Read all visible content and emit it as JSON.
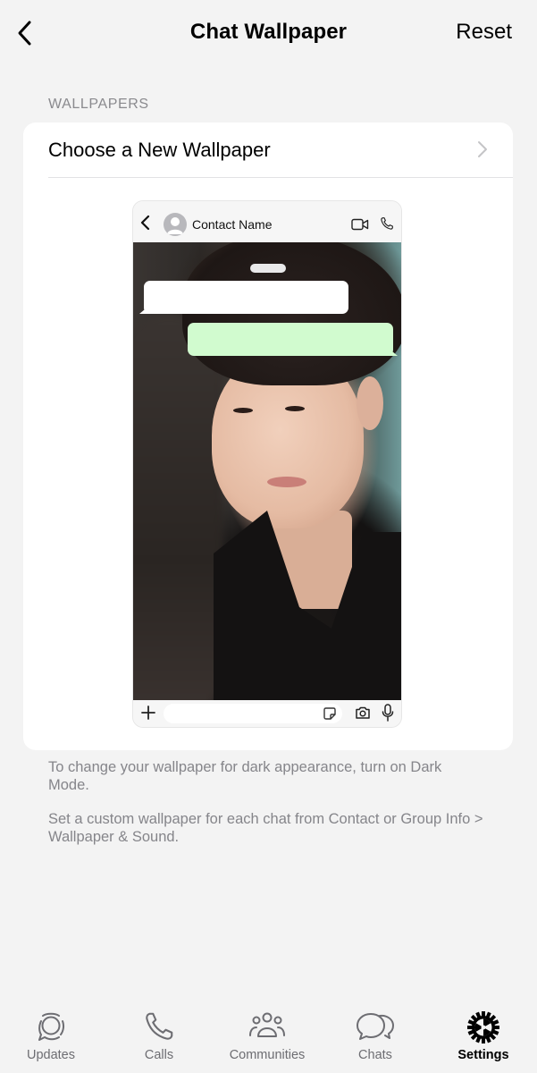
{
  "header": {
    "title": "Chat Wallpaper",
    "reset_label": "Reset",
    "back_icon": "chevron-left-icon"
  },
  "wallpapers_section": {
    "header": "WALLPAPERS",
    "choose_row_label": "Choose a New Wallpaper",
    "choose_row_icon": "chevron-right-icon"
  },
  "preview": {
    "contact_name": "Contact Name",
    "icons": [
      "chevron-left-icon",
      "avatar-icon",
      "video-call-icon",
      "phone-icon",
      "plus-icon",
      "sticker-icon",
      "camera-icon",
      "microphone-icon"
    ],
    "incoming_bubble_color": "#ffffff",
    "outgoing_bubble_color": "#d1fbcf"
  },
  "footnotes": {
    "dark_mode": "To change your wallpaper for dark appearance, turn on Dark Mode.",
    "custom": "Set a custom wallpaper for each chat from Contact or Group Info > Wallpaper & Sound."
  },
  "tabbar": {
    "tabs": [
      {
        "label": "Updates",
        "icon": "updates-icon",
        "active": false
      },
      {
        "label": "Calls",
        "icon": "phone-icon",
        "active": false
      },
      {
        "label": "Communities",
        "icon": "communities-icon",
        "active": false
      },
      {
        "label": "Chats",
        "icon": "chats-icon",
        "active": false
      },
      {
        "label": "Settings",
        "icon": "settings-gear-icon",
        "active": true
      }
    ]
  },
  "colors": {
    "background": "#f3f3f3",
    "card": "#ffffff",
    "secondary_text": "#8a8a8e",
    "active_tab": "#000000",
    "inactive_tab": "#6d6d72"
  }
}
